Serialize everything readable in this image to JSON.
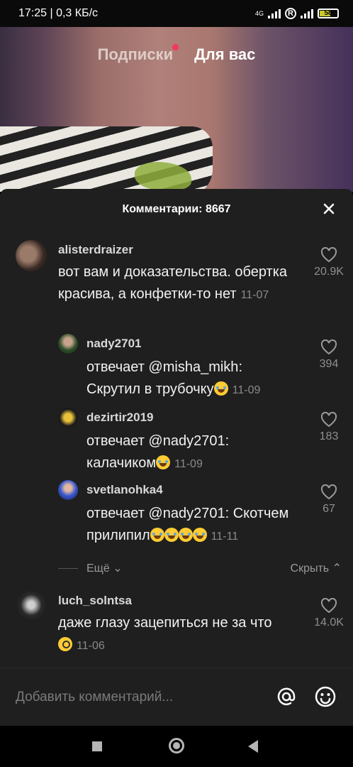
{
  "status_bar": {
    "time_speed": "17:25 | 0,3 КБ/с",
    "network": "4G",
    "roaming": "R",
    "battery": "58"
  },
  "top_tabs": {
    "following": "Подписки",
    "for_you": "Для вас"
  },
  "comments_sheet": {
    "title": "Комментарии: 8667",
    "comments": [
      {
        "user": "alisterdraizer",
        "text": "вот вам и доказательства. обертка красива, а конфетки-то нет",
        "date": "11-07",
        "likes": "20.9K"
      },
      {
        "user": "nady2701",
        "prefix": "отвечает ",
        "mention": "@misha_mikh",
        "text": ": Скрутил в трубочку",
        "date": "11-09",
        "likes": "394"
      },
      {
        "user": "dezirtir2019",
        "prefix": "отвечает ",
        "mention": "@nady2701",
        "text": ": калачиком",
        "date": "11-09",
        "likes": "183"
      },
      {
        "user": "svetlanohka4",
        "prefix": "отвечает ",
        "mention": "@nady2701",
        "text": ": Скотчем прилипил",
        "date": "11-11",
        "likes": "67"
      },
      {
        "user": "luch_solntsa",
        "text": "даже глазу зацепиться не за что",
        "date": "11-06",
        "likes": "14.0K"
      }
    ],
    "more_label": "Ещё",
    "hide_label": "Скрыть"
  },
  "composer": {
    "placeholder": "Добавить комментарий..."
  },
  "colors": {
    "sheet_bg": "#1f1f1f",
    "live_dot": "#ff2b55"
  }
}
